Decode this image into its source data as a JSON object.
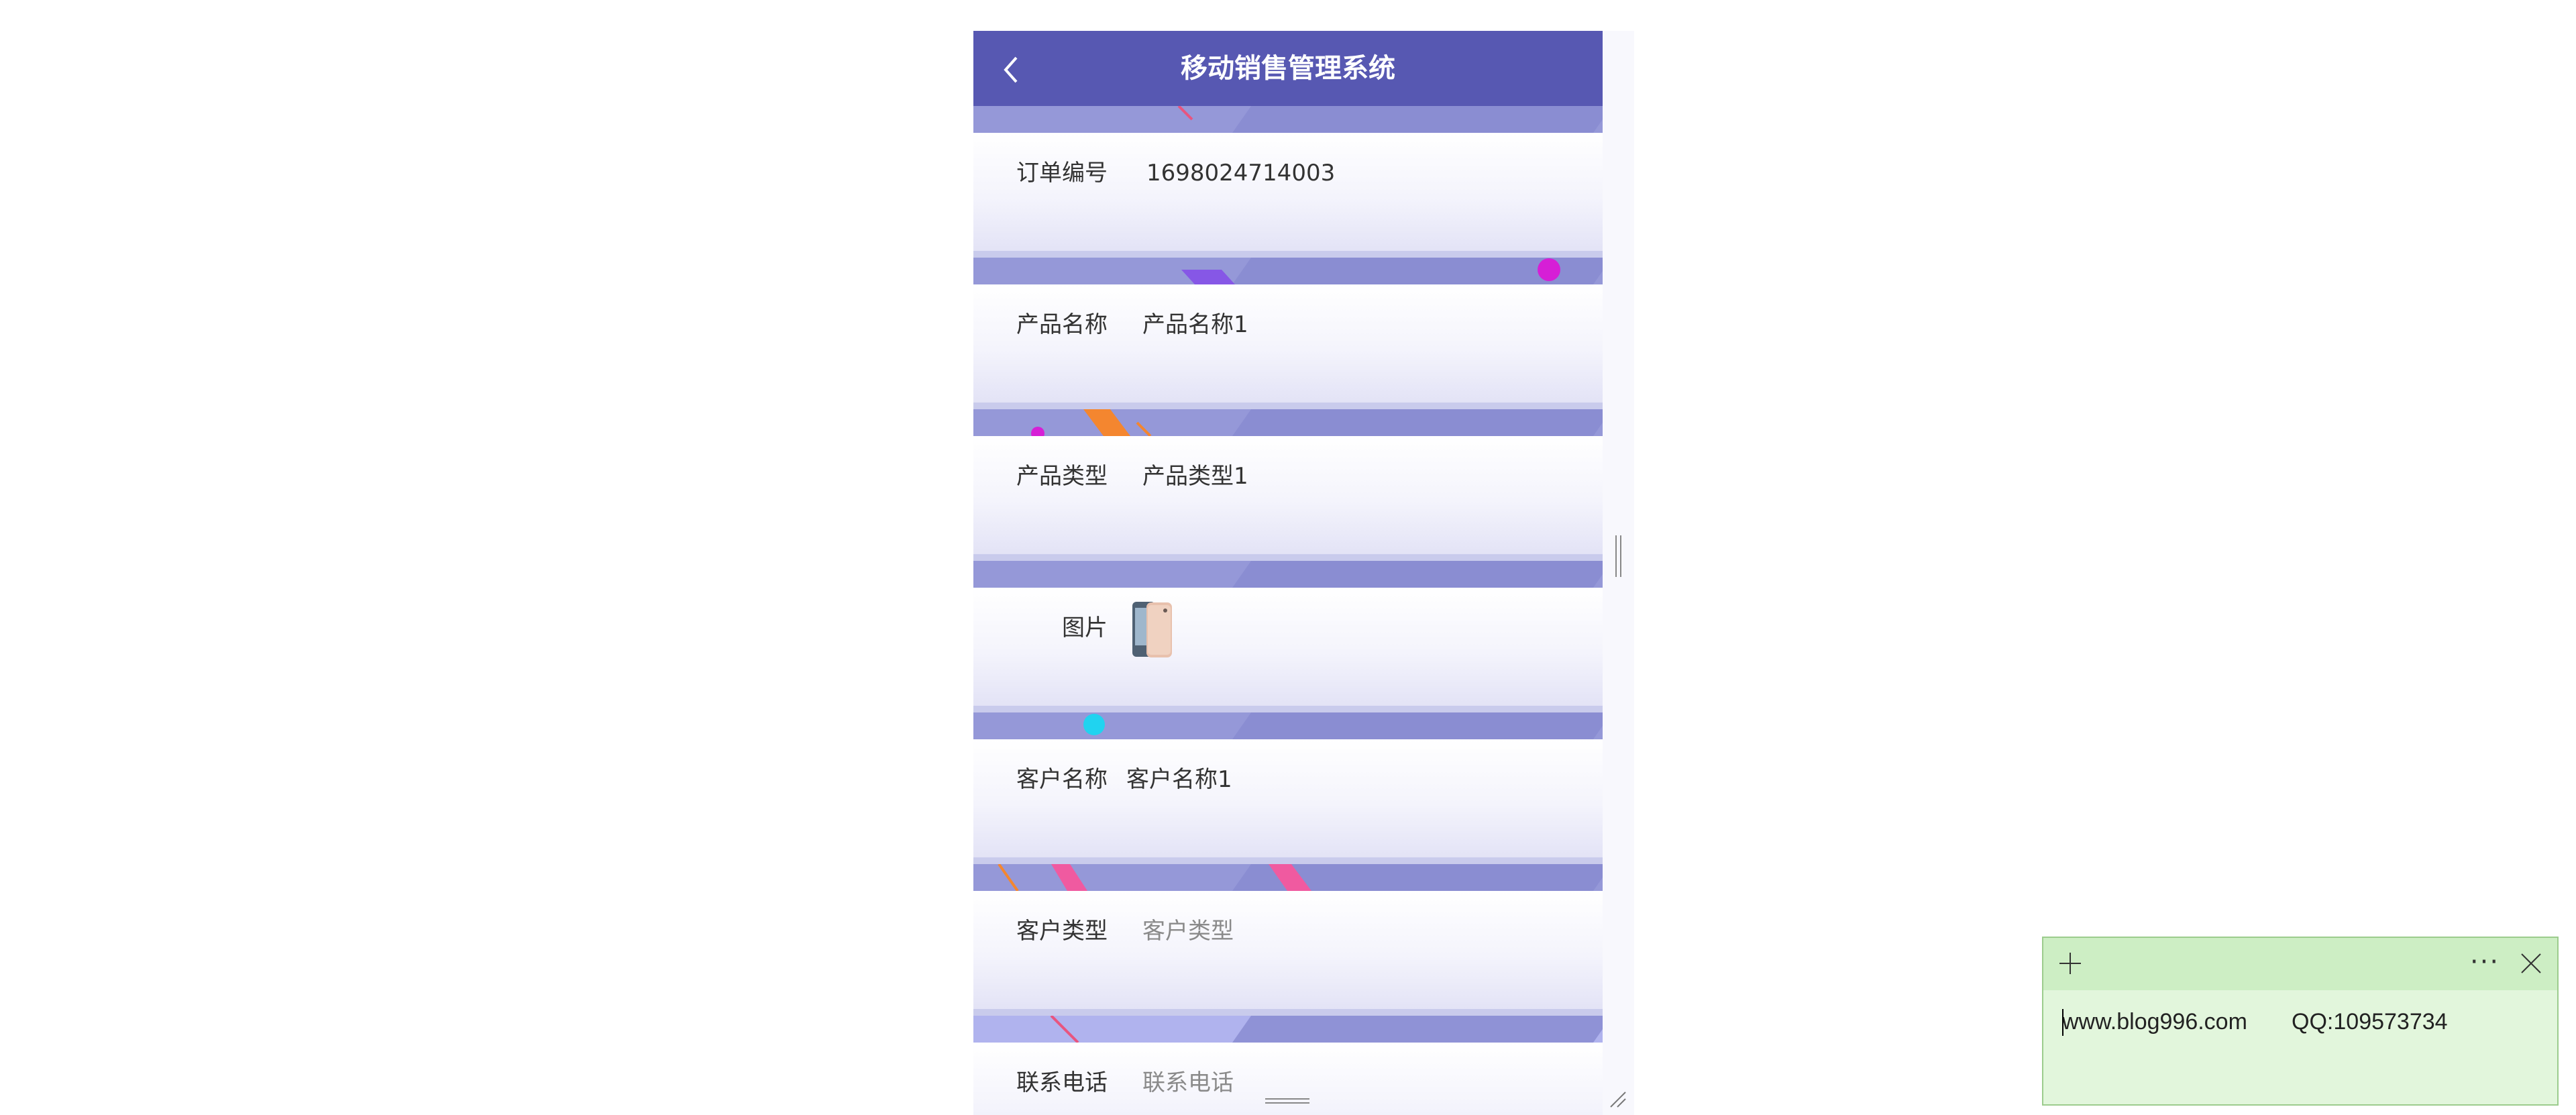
{
  "header": {
    "title": "移动销售管理系统"
  },
  "fields": [
    {
      "label": "订单编号",
      "value": "1698024714003"
    },
    {
      "label": "产品名称",
      "value": "产品名称1"
    },
    {
      "label": "产品类型",
      "value": "产品类型1"
    },
    {
      "label": "图片",
      "value": ""
    },
    {
      "label": "客户名称",
      "value": "客户名称1"
    },
    {
      "label": "客户类型",
      "placeholder": "客户类型"
    },
    {
      "label": "联系电话",
      "placeholder": "联系电话"
    }
  ],
  "sticky_note": {
    "text": "www.blog996.com       QQ:109573734"
  },
  "colors": {
    "header": "#5758b2",
    "stripe": "#9598d8",
    "note_bg": "#e2f6dc",
    "note_bar": "#cdeec4"
  }
}
